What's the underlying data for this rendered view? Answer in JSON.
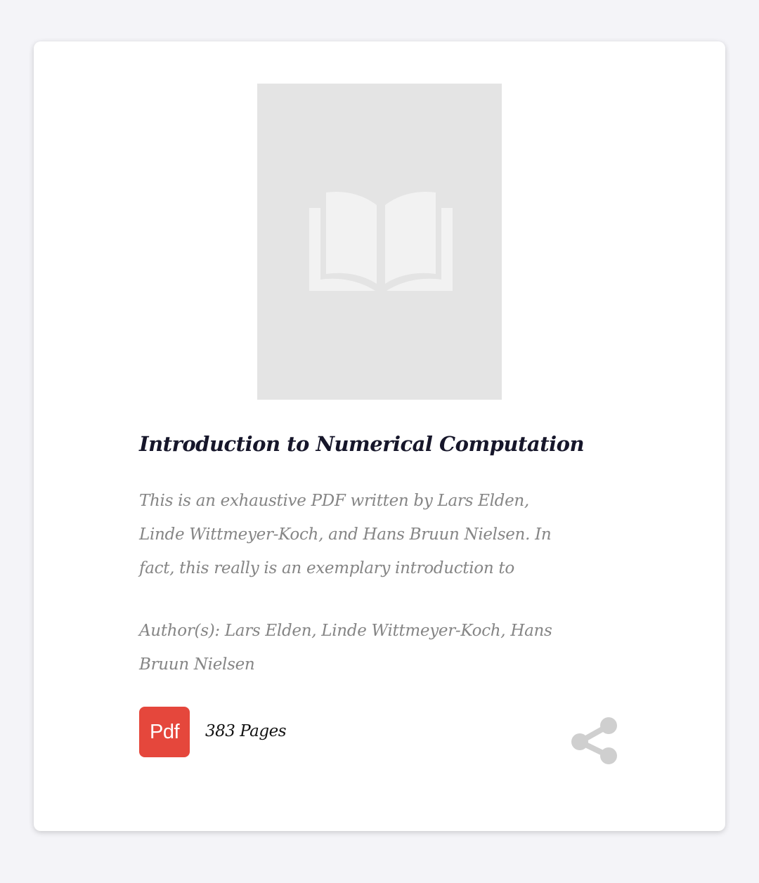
{
  "book": {
    "title": "Introduction to Numerical Computation",
    "description": "This is an exhaustive PDF written by Lars Elden, Linde Wittmeyer-Koch, and Hans Bruun Nielsen. In fact, this really is an exemplary introduction to",
    "authors": "Author(s): Lars Elden, Linde Wittmeyer-Koch, Hans Bruun Nielsen",
    "pages": "383 Pages",
    "format_badge": "Pdf"
  },
  "icons": {
    "cover_placeholder": "open-book-icon",
    "format": "pdf-icon",
    "share": "share-icon"
  },
  "colors": {
    "background": "#f4f4f8",
    "card": "#ffffff",
    "cover_placeholder": "#e4e4e4",
    "title": "#16162a",
    "muted_text": "#858585",
    "pdf_badge": "#e5473c",
    "share_icon": "#cfcfcf"
  }
}
